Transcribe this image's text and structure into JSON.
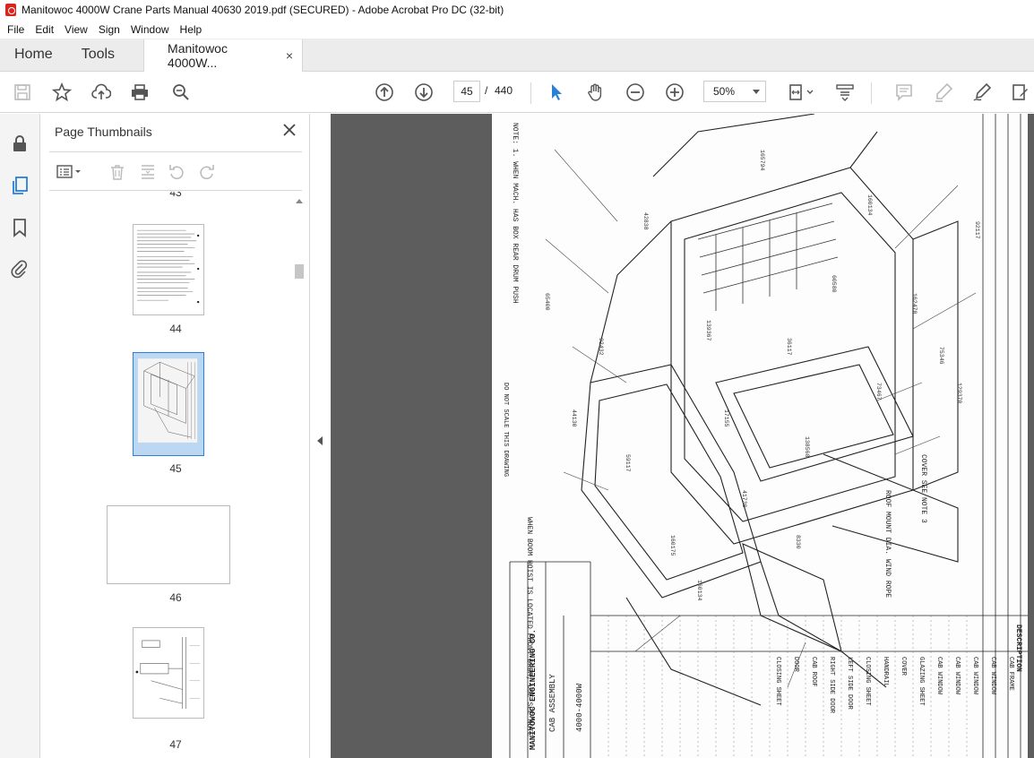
{
  "window": {
    "title": "Manitowoc 4000W Crane Parts Manual 40630 2019.pdf (SECURED) - Adobe Acrobat Pro DC (32-bit)"
  },
  "menu": [
    "File",
    "Edit",
    "View",
    "Sign",
    "Window",
    "Help"
  ],
  "tabs": {
    "home": "Home",
    "tools": "Tools",
    "document": "Manitowoc 4000W...",
    "close_glyph": "×"
  },
  "toolbar": {
    "current_page": "45",
    "page_separator": "/",
    "total_pages": "440",
    "zoom": "50%"
  },
  "thumbnails_panel": {
    "title": "Page Thumbnails",
    "close_glyph": "✕",
    "partial_label": "43",
    "pages": [
      {
        "label": "44",
        "selected": false
      },
      {
        "label": "45",
        "selected": true
      },
      {
        "label": "46",
        "selected": false
      },
      {
        "label": "47",
        "selected": false
      }
    ]
  },
  "drawing": {
    "title_block": {
      "company": "MANITOWOC ENGINEERING CO.",
      "model": "4000-4000W",
      "assembly": "CAB ASSEMBLY"
    },
    "parts_columns": {
      "description_header": "DESCRIPTION",
      "rows": [
        "CAB FRAME",
        "CAB WINDOW",
        "CAB WINDOW",
        "CAB WINDOW",
        "CAB WINDOW",
        "GLAZING SHEET",
        "COVER",
        "HANDRAIL",
        "CLOSING SHEET",
        "LEFT SIDE DOOR",
        "RIGHT SIDE DOOR",
        "CAB ROOF",
        "DOOR",
        "CLOSING SHEET"
      ]
    },
    "notes": {
      "note_a": "NOTE: 1. WHEN MACH. HAS BOX REAR DRUM PUSH",
      "note_b": "DO NOT SCALE THIS DRAWING",
      "note_c": "WHEN BOOM HOIST IS LOCATED FRONT DRUM, USE SEE NOTE",
      "note_d": "COVER SEE NOTE 3",
      "note_e": "ROOF MOUNT DIA. WIND ROPE"
    },
    "part_numbers": [
      "165794",
      "160134",
      "42838",
      "139367",
      "36117",
      "17155",
      "73467",
      "59117",
      "138568",
      "160175",
      "41730",
      "92432",
      "162470",
      "75346",
      "65400",
      "44130",
      "160134",
      "8330",
      "92117",
      "129370",
      "60580"
    ]
  },
  "colors": {
    "accent": "#2b7fd6",
    "tab_bar": "#ececec",
    "doc_background": "#5d5d5d",
    "icon": "#555555"
  }
}
